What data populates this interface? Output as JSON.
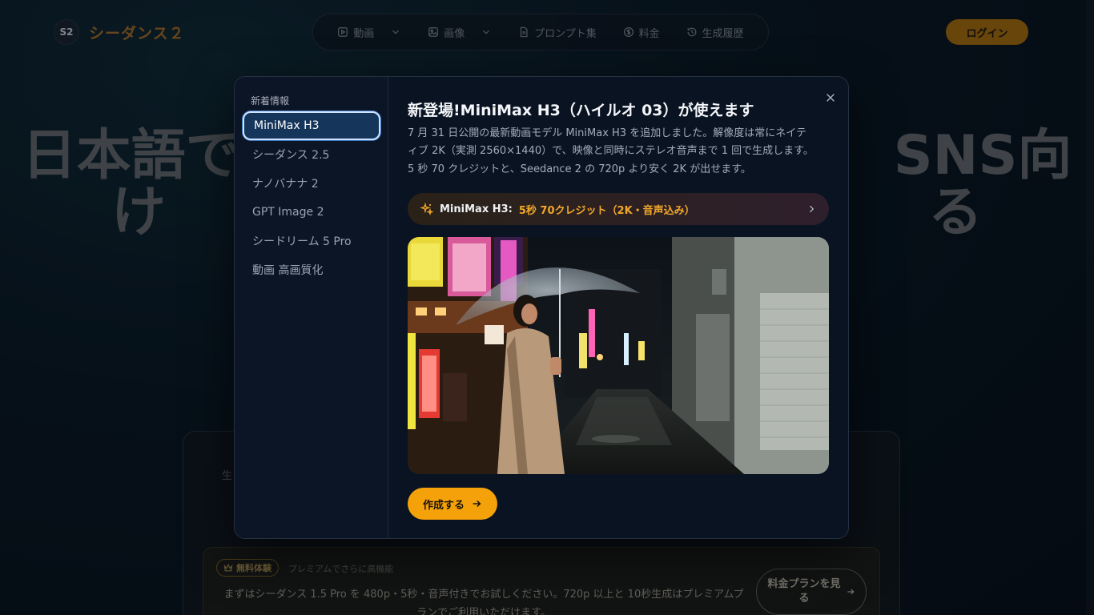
{
  "app": {
    "logo_badge": "S2",
    "logo_text": "シーダンス２"
  },
  "nav": {
    "items": [
      {
        "label": "動画",
        "icon": "play-square-icon",
        "has_dropdown": true
      },
      {
        "label": "画像",
        "icon": "image-icon",
        "has_dropdown": true
      },
      {
        "label": "プロンプト集",
        "icon": "document-icon",
        "has_dropdown": false
      },
      {
        "label": "料金",
        "icon": "dollar-circle-icon",
        "has_dropdown": false
      },
      {
        "label": "生成履歴",
        "icon": "history-icon",
        "has_dropdown": false
      }
    ],
    "login": "ログイン"
  },
  "hero": {
    "title_line1": "日本語で　　　　　　　　　　　　SNS向",
    "title_line2": "け　　　　　　　　　　　　　　る",
    "card_label": "生",
    "promo": {
      "badge": "無料体験",
      "subtitle": "プレミアムでさらに高機能",
      "text": "まずはシーダンス 1.5 Pro を 480p・5秒・音声付きでお試しください。720p 以上と 10秒生成はプレミアムプランでご利用いただけます。",
      "plan_button": "料金プランを見る"
    }
  },
  "modal": {
    "side_heading": "新着情報",
    "side_items": [
      {
        "label": "MiniMax H3",
        "active": true
      },
      {
        "label": "シーダンス 2.5",
        "active": false
      },
      {
        "label": "ナノバナナ 2",
        "active": false
      },
      {
        "label": "GPT Image 2",
        "active": false
      },
      {
        "label": "シードリーム 5 Pro",
        "active": false
      },
      {
        "label": "動画 高画質化",
        "active": false
      }
    ],
    "title": "新登場!MiniMax H3（ハイルオ 03）が使えます",
    "description": "7 月 31 日公開の最新動画モデル MiniMax H3 を追加しました。解像度は常にネイティブ 2K（実測 2560×1440）で、映像と同時にステレオ音声まで 1 回で生成します。5 秒 70 クレジットと、Seedance 2 の 720p より安く 2K が出せます。",
    "callout_name": "MiniMax H3:",
    "callout_detail": "5秒 70クレジット（2K・音声込み）",
    "create_button": "作成する",
    "colors": {
      "accent": "#f5a20a",
      "active_item_bg": "#15365a",
      "callout_text": "#f2a82a"
    }
  }
}
